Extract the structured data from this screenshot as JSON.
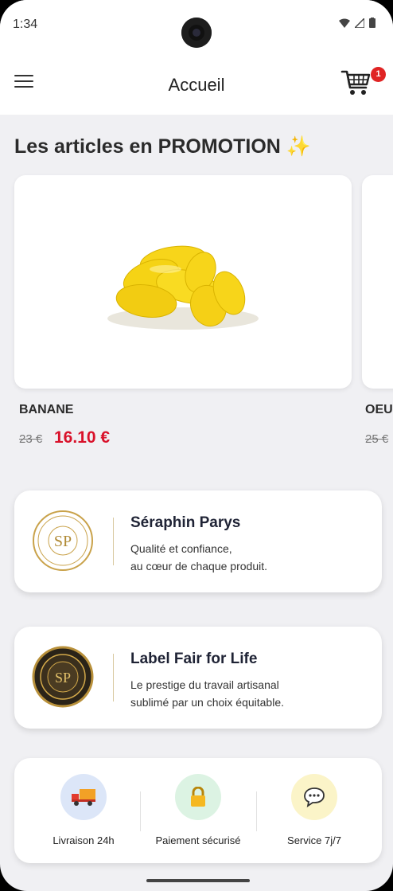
{
  "status_bar": {
    "time": "1:34"
  },
  "app_bar": {
    "title": "Accueil",
    "cart_count": "1"
  },
  "section": {
    "title": "Les articles en PROMOTION",
    "emoji": "✨"
  },
  "products": [
    {
      "name": "BANANE",
      "old_price": "23 €",
      "new_price": "16.10 €"
    },
    {
      "name": "OEU",
      "old_price": "25 €"
    }
  ],
  "info_cards": [
    {
      "title": "Séraphin Parys",
      "line1": "Qualité et confiance,",
      "line2": "au cœur de chaque produit.",
      "logo_text": "SP"
    },
    {
      "title": "Label Fair for Life",
      "line1": "Le prestige du travail artisanal",
      "line2": "sublimé par un choix équitable.",
      "logo_text": "SP"
    }
  ],
  "features": [
    {
      "label": "Livraison 24h",
      "icon": "delivery-truck-icon"
    },
    {
      "label": "Paiement sécurisé",
      "icon": "lock-icon"
    },
    {
      "label": "Service 7j/7",
      "icon": "speech-bubble-icon"
    }
  ],
  "colors": {
    "promo_price": "#d9112a",
    "badge": "#e02424",
    "gold": "#c9a24a"
  }
}
